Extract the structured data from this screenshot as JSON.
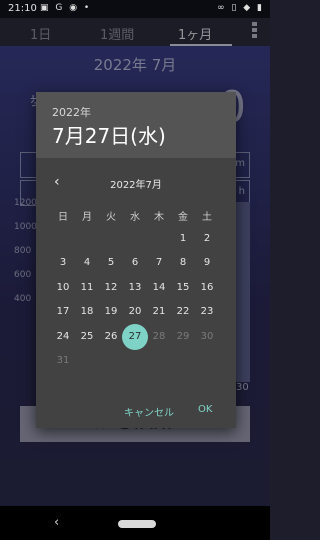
{
  "status_bar": {
    "time": "21:10"
  },
  "tabs": {
    "t1": "1日",
    "t2": "1週間",
    "t3": "1ヶ月"
  },
  "background": {
    "month_title": "2022年 7月",
    "label": "歩数",
    "digit": "0",
    "unit1": "m",
    "unit2": "h",
    "axis_labels": [
      "1200",
      "1000",
      "800",
      "600",
      "400"
    ],
    "axis30": "30",
    "start_label": "≫ START"
  },
  "dialog": {
    "header_year": "2022年",
    "header_date": "7月27日(水)",
    "month_label": "2022年7月",
    "weekdays": [
      "日",
      "月",
      "火",
      "水",
      "木",
      "金",
      "土"
    ],
    "weeks": [
      [
        "",
        "",
        "",
        "",
        "",
        "1",
        "2"
      ],
      [
        "3",
        "4",
        "5",
        "6",
        "7",
        "8",
        "9"
      ],
      [
        "10",
        "11",
        "12",
        "13",
        "14",
        "15",
        "16"
      ],
      [
        "17",
        "18",
        "19",
        "20",
        "21",
        "22",
        "23"
      ],
      [
        "24",
        "25",
        "26",
        "27",
        "28",
        "29",
        "30"
      ],
      [
        "31",
        "",
        "",
        "",
        "",
        "",
        ""
      ]
    ],
    "selected_day": "27",
    "disabled_days": [
      "28",
      "29",
      "30",
      "31"
    ],
    "cancel_label": "キャンセル",
    "ok_label": "OK"
  },
  "colors": {
    "accent": "#7fd3c6",
    "dialog_bg": "#424242",
    "header_bg": "#545454"
  }
}
